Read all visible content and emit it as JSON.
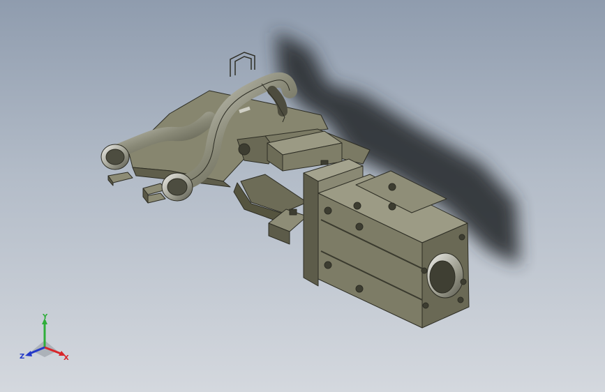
{
  "viewport": {
    "background_top": "#8f9cae",
    "background_bottom": "#d4d8de",
    "part_color": "#76755f",
    "shadow_color": "#2b2f33"
  },
  "triad": {
    "x_label": "X",
    "y_label": "Y",
    "z_label": "Z",
    "x_color": "#d8262a",
    "y_color": "#2fae3a",
    "z_color": "#2439c8"
  }
}
